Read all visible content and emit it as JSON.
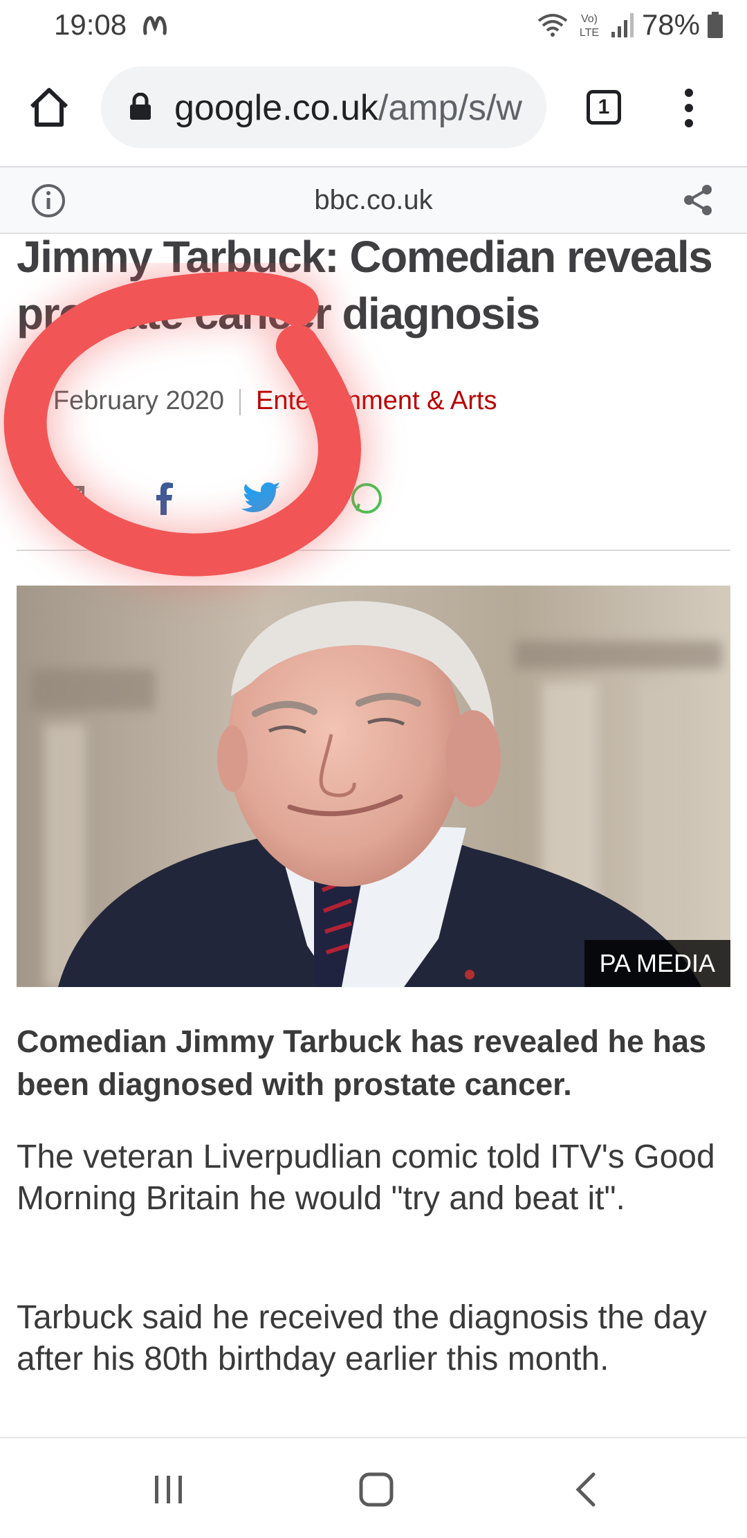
{
  "status_bar": {
    "time": "19:08",
    "battery_percent": "78%",
    "icons": [
      "m-notification-icon",
      "wifi-icon",
      "volte-lte-icon",
      "signal-icon",
      "battery-icon"
    ]
  },
  "browser": {
    "url_host": "google.co.uk",
    "url_path": "/amp/s/w",
    "tab_count": "1",
    "icons": [
      "home-icon",
      "lock-icon",
      "tab-switcher-icon",
      "more-menu-icon"
    ]
  },
  "amp_header": {
    "domain": "bbc.co.uk",
    "icons": [
      "info-icon",
      "share-icon"
    ]
  },
  "article": {
    "headline": "Jimmy Tarbuck: Comedian reveals prostate cancer diagnosis",
    "date": "19 February 2020",
    "category": "Entertainment & Arts",
    "share_icons": [
      "email-icon",
      "facebook-icon",
      "twitter-icon",
      "whatsapp-icon"
    ],
    "image_credit": "PA MEDIA",
    "lead": "Comedian Jimmy Tarbuck has revealed he has been diagnosed with prostate cancer.",
    "paragraphs": [
      "The veteran Liverpudlian comic told ITV's Good Morning Britain he would \"try and beat it\".",
      "Tarbuck said he received the diagnosis the day after his 80th birthday earlier this month."
    ]
  },
  "nav_bar": {
    "icons": [
      "recent-apps-icon",
      "home-nav-icon",
      "back-icon"
    ]
  },
  "colors": {
    "category_red": "#b80000",
    "facebook_blue": "#3b5998",
    "twitter_blue": "#1da1f2",
    "annotation_red": "#f25555"
  }
}
